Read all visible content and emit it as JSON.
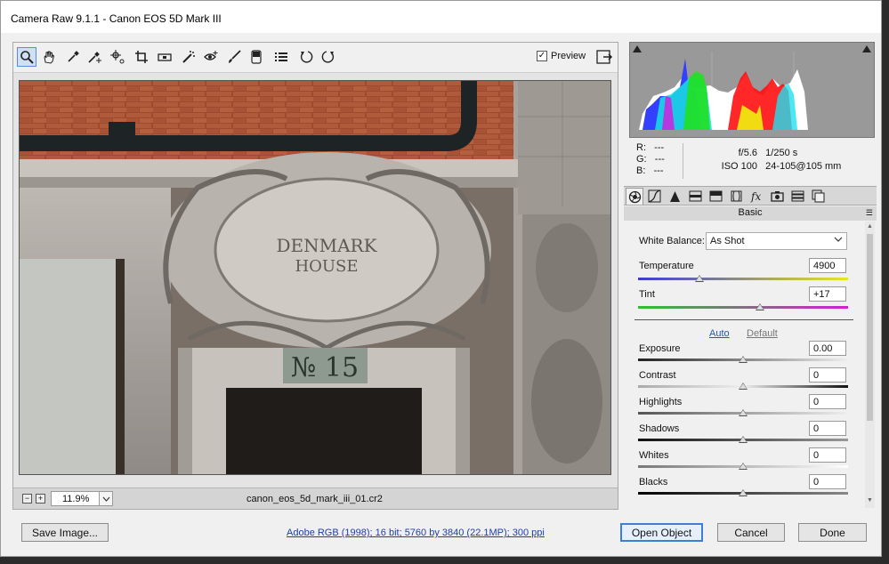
{
  "window": {
    "title": "Camera Raw 9.1.1  -  Canon EOS 5D Mark III"
  },
  "toolbar": {
    "tools": [
      {
        "name": "zoom-tool",
        "icon": "magnifier-icon",
        "active": true
      },
      {
        "name": "hand-tool",
        "icon": "hand-icon"
      },
      {
        "name": "white-balance-tool",
        "icon": "eyedropper-icon"
      },
      {
        "name": "color-sampler-tool",
        "icon": "color-sampler-icon"
      },
      {
        "name": "targeted-adjustment-tool",
        "icon": "target-icon"
      },
      {
        "name": "crop-tool",
        "icon": "crop-icon"
      },
      {
        "name": "straighten-tool",
        "icon": "level-icon"
      },
      {
        "name": "spot-removal-tool",
        "icon": "spot-removal-icon"
      },
      {
        "name": "red-eye-tool",
        "icon": "red-eye-icon"
      },
      {
        "name": "adjustment-brush-tool",
        "icon": "brush-icon"
      },
      {
        "name": "graduated-filter-tool",
        "icon": "graduated-filter-icon"
      },
      {
        "name": "preferences-tool",
        "icon": "list-icon"
      },
      {
        "name": "rotate-left-tool",
        "icon": "rotate-left-icon"
      },
      {
        "name": "rotate-right-tool",
        "icon": "rotate-right-icon"
      }
    ],
    "preview_label": "Preview",
    "preview_checked": "✓"
  },
  "statusbar": {
    "zoom_out": "−",
    "zoom_in": "+",
    "zoom_value": "11.9%",
    "filename": "canon_eos_5d_mark_iii_01.cr2"
  },
  "photo": {
    "sign_line1": "DENMARK",
    "sign_line2": "HOUSE",
    "number": "№ 15"
  },
  "info": {
    "r_label": "R:",
    "r_value": "---",
    "g_label": "G:",
    "g_value": "---",
    "b_label": "B:",
    "b_value": "---",
    "aperture": "f/5.6",
    "shutter": "1/250 s",
    "iso": "ISO 100",
    "lens": "24-105@105 mm"
  },
  "panel": {
    "header": "Basic",
    "menu_icon": "☰"
  },
  "basic": {
    "white_balance_label": "White Balance:",
    "white_balance_value": "As Shot",
    "temperature_label": "Temperature",
    "temperature_value": "4900",
    "tint_label": "Tint",
    "tint_value": "+17",
    "auto_label": "Auto",
    "default_label": "Default",
    "exposure_label": "Exposure",
    "exposure_value": "0.00",
    "contrast_label": "Contrast",
    "contrast_value": "0",
    "highlights_label": "Highlights",
    "highlights_value": "0",
    "shadows_label": "Shadows",
    "shadows_value": "0",
    "whites_label": "Whites",
    "whites_value": "0",
    "blacks_label": "Blacks",
    "blacks_value": "0"
  },
  "bottom": {
    "save_label": "Save Image...",
    "workflow_label": "Adobe RGB (1998); 16 bit; 5760 by 3840 (22.1MP); 300 ppi",
    "open_label": "Open Object",
    "cancel_label": "Cancel",
    "done_label": "Done"
  },
  "colors": {
    "accent": "#3c7fd8",
    "link": "#1d3fa8",
    "histogram_bg": "#999999"
  }
}
